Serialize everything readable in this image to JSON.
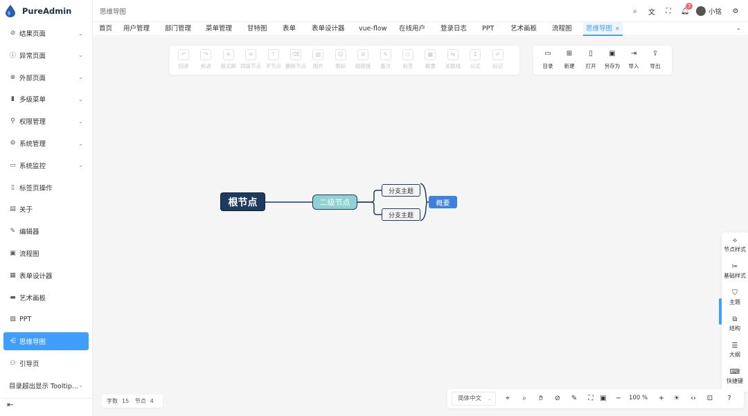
{
  "app": {
    "name": "PureAdmin"
  },
  "sidebar": {
    "items": [
      {
        "label": "结果页面",
        "icon": "check-circle-icon",
        "glyph": "⊘",
        "has_children": true
      },
      {
        "label": "异常页面",
        "icon": "info-circle-icon",
        "glyph": "ⓘ",
        "has_children": true
      },
      {
        "label": "外部页面",
        "icon": "link-icon",
        "glyph": "⊗",
        "has_children": true
      },
      {
        "label": "多级菜单",
        "icon": "bar-chart-icon",
        "glyph": "▮",
        "has_children": true
      },
      {
        "label": "权限管理",
        "icon": "key-icon",
        "glyph": "⚲",
        "has_children": true
      },
      {
        "label": "系统管理",
        "icon": "gear-icon",
        "glyph": "⚙",
        "has_children": true
      },
      {
        "label": "系统监控",
        "icon": "monitor-icon",
        "glyph": "▭",
        "has_children": true
      },
      {
        "label": "标签页操作",
        "icon": "bookmark-icon",
        "glyph": "▯",
        "has_children": false
      },
      {
        "label": "关于",
        "icon": "document-icon",
        "glyph": "▤",
        "has_children": false
      },
      {
        "label": "编辑器",
        "icon": "edit-icon",
        "glyph": "✎",
        "has_children": false
      },
      {
        "label": "流程图",
        "icon": "flow-icon",
        "glyph": "▣",
        "has_children": false
      },
      {
        "label": "表单设计器",
        "icon": "form-icon",
        "glyph": "▦",
        "has_children": false
      },
      {
        "label": "艺术画板",
        "icon": "board-icon",
        "glyph": "▬",
        "has_children": false
      },
      {
        "label": "PPT",
        "icon": "ppt-icon",
        "glyph": "▧",
        "has_children": false
      },
      {
        "label": "思维导图",
        "icon": "mindmap-icon",
        "glyph": "⋲",
        "has_children": false,
        "active": true
      },
      {
        "label": "引导页",
        "icon": "guide-icon",
        "glyph": "⚇",
        "has_children": false
      },
      {
        "label": "目录超出显示 Tooltip...",
        "icon": "",
        "glyph": "",
        "has_children": true
      }
    ],
    "collapse_icon": "collapse-menu-icon"
  },
  "header": {
    "breadcrumb": "思维导图",
    "username": "小铭",
    "notification_count": "7"
  },
  "tabs": [
    {
      "label": "首页"
    },
    {
      "label": "用户管理"
    },
    {
      "label": "部门管理"
    },
    {
      "label": "菜单管理"
    },
    {
      "label": "甘特图"
    },
    {
      "label": "表单"
    },
    {
      "label": "表单设计器"
    },
    {
      "label": "vue-flow"
    },
    {
      "label": "在线用户"
    },
    {
      "label": "登录日志"
    },
    {
      "label": "PPT"
    },
    {
      "label": "艺术画板"
    },
    {
      "label": "流程图"
    },
    {
      "label": "思维导图",
      "active": true
    }
  ],
  "toolbar_main": [
    {
      "label": "回退",
      "icon": "undo-icon",
      "glyph": "↶"
    },
    {
      "label": "前进",
      "icon": "redo-icon",
      "glyph": "↷"
    },
    {
      "label": "格式刷",
      "icon": "format-brush-icon",
      "glyph": "⁜"
    },
    {
      "label": "同级节点",
      "icon": "sibling-node-icon",
      "glyph": "⁜"
    },
    {
      "label": "子节点",
      "icon": "child-node-icon",
      "glyph": "⊤"
    },
    {
      "label": "删除节点",
      "icon": "delete-node-icon",
      "glyph": "⌫"
    },
    {
      "label": "图片",
      "icon": "image-icon",
      "glyph": "▨"
    },
    {
      "label": "图标",
      "icon": "emoji-icon",
      "glyph": "☺"
    },
    {
      "label": "超链接",
      "icon": "hyperlink-icon",
      "glyph": "⊘"
    },
    {
      "label": "备注",
      "icon": "note-icon",
      "glyph": "✎"
    },
    {
      "label": "标签",
      "icon": "tag-icon",
      "glyph": "◇"
    },
    {
      "label": "概要",
      "icon": "summary-icon",
      "glyph": "▦"
    },
    {
      "label": "关联线",
      "icon": "relation-line-icon",
      "glyph": "⇆"
    },
    {
      "label": "公式",
      "icon": "formula-icon",
      "glyph": "Σ"
    },
    {
      "label": "标记",
      "icon": "mark-icon",
      "glyph": "✐"
    }
  ],
  "toolbar_file": [
    {
      "label": "目录",
      "icon": "folder-icon",
      "glyph": "▭"
    },
    {
      "label": "新建",
      "icon": "new-file-icon",
      "glyph": "⊞"
    },
    {
      "label": "打开",
      "icon": "open-file-icon",
      "glyph": "▯"
    },
    {
      "label": "另存为",
      "icon": "save-as-icon",
      "glyph": "▣"
    },
    {
      "label": "导入",
      "icon": "import-icon",
      "glyph": "⇥"
    },
    {
      "label": "导出",
      "icon": "export-icon",
      "glyph": "⇪"
    }
  ],
  "mindmap": {
    "root": "根节点",
    "second": "二级节点",
    "branch_1": "分支主题",
    "branch_2": "分支主题",
    "summary": "概要",
    "line_color": "#1f3a5f"
  },
  "right_panel": [
    {
      "label": "节点样式",
      "icon": "node-style-icon",
      "glyph": "⟡"
    },
    {
      "label": "基础样式",
      "icon": "base-style-icon",
      "glyph": "✂"
    },
    {
      "label": "主题",
      "icon": "theme-icon",
      "glyph": "⛉"
    },
    {
      "label": "结构",
      "icon": "structure-icon",
      "glyph": "⧉"
    },
    {
      "label": "大纲",
      "icon": "outline-icon",
      "glyph": "☰"
    },
    {
      "label": "快捷键",
      "icon": "keyboard-icon",
      "glyph": "⌨"
    }
  ],
  "status": {
    "word_label": "字数",
    "word_count": "15",
    "node_label": "节点",
    "node_count": "4"
  },
  "bottom_toolbar": {
    "language": "简体中文",
    "zoom": "100",
    "zoom_unit": "%"
  },
  "colors": {
    "accent": "#409eff",
    "root_bg": "#1f3a5f",
    "second_bg": "#8fd1d4",
    "summary_bg": "#3b82e0",
    "badge": "#f56c6c"
  }
}
